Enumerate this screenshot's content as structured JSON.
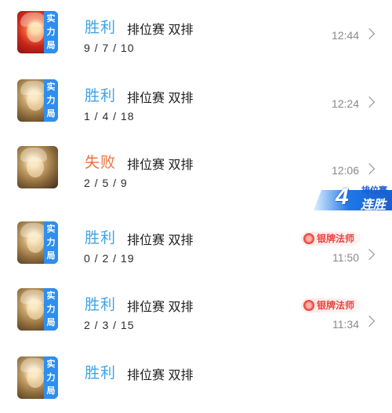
{
  "matches": [
    {
      "result": "胜利",
      "result_type": "win",
      "mode": "排位赛 双排",
      "kda": "9 / 7 / 10",
      "time": "12:44",
      "tag": [
        "实",
        "力",
        "局"
      ],
      "hero": "hero-a",
      "title_badge": ""
    },
    {
      "result": "胜利",
      "result_type": "win",
      "mode": "排位赛 双排",
      "kda": "1 / 4 / 18",
      "time": "12:24",
      "tag": [
        "实",
        "力",
        "局"
      ],
      "hero": "hero-b",
      "title_badge": ""
    },
    {
      "result": "失败",
      "result_type": "lose",
      "mode": "排位赛 双排",
      "kda": "2 / 5 / 9",
      "time": "12:06",
      "tag": [],
      "hero": "hero-b",
      "title_badge": ""
    },
    {
      "result": "胜利",
      "result_type": "win",
      "mode": "排位赛 双排",
      "kda": "0 / 2 / 19",
      "time": "11:50",
      "tag": [
        "实",
        "力",
        "局"
      ],
      "hero": "hero-b",
      "title_badge": "银牌法师"
    },
    {
      "result": "胜利",
      "result_type": "win",
      "mode": "排位赛 双排",
      "kda": "2 / 3 / 15",
      "time": "11:34",
      "tag": [
        "实",
        "力",
        "局"
      ],
      "hero": "hero-b",
      "title_badge": "银牌法师"
    },
    {
      "result": "胜利",
      "result_type": "win",
      "mode": "排位赛 双排",
      "kda": "",
      "time": "",
      "tag": [
        "实",
        "力",
        "局"
      ],
      "hero": "hero-b",
      "title_badge": ""
    }
  ],
  "streak": {
    "count": "4",
    "label_top": "排位赛",
    "label_main": "连胜"
  },
  "colors": {
    "win": "#3ea4e6",
    "lose": "#f0703c",
    "tag": "#2f8ef0",
    "badge": "#e8453c"
  },
  "icons": {
    "chevron": "chevron-right-icon",
    "medal": "medal-icon"
  }
}
